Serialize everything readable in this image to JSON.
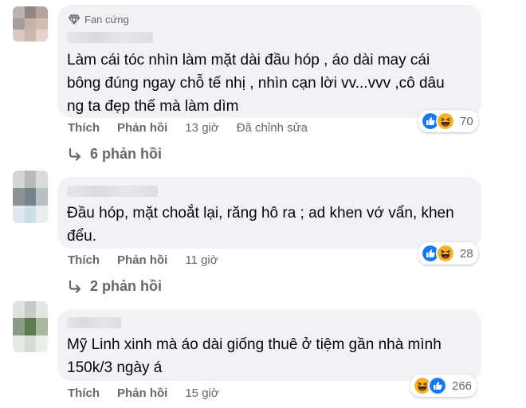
{
  "comments": [
    {
      "badge": "Fan cứng",
      "text": "Làm cái tóc nhìn làm mặt dài đầu hóp , áo dài may cái\nbông đúng ngay chỗ tế nhị , nhìn cạn lời vv...vvv ,cô dâu\nng ta đẹp thế mà làm dìm",
      "like": "Thích",
      "reply": "Phản hồi",
      "time": "13 giờ",
      "edited": "Đã chỉnh sửa",
      "reaction_count": "70",
      "replies": "6 phản hồi"
    },
    {
      "text": "Đầu hóp, mặt choắt lại, răng hô ra ; ad khen vớ vẩn, khen\nđểu.",
      "like": "Thích",
      "reply": "Phản hồi",
      "time": "11 giờ",
      "reaction_count": "28",
      "replies": "2 phản hồi"
    },
    {
      "text": "Mỹ Linh xinh mà áo dài giống thuê ở tiệm gần nhà mình\n150k/3 ngày á",
      "like": "Thích",
      "reply": "Phản hồi",
      "time": "15 giờ",
      "reaction_count": "266"
    }
  ],
  "colors": {
    "bubble": "#f0f2f5",
    "secondary_text": "#65676b",
    "like_blue": "#1877f2",
    "haha_yellow": "#f7b125"
  },
  "icons": [
    "diamond-icon",
    "like-reaction-icon",
    "haha-reaction-icon",
    "reply-arrow-icon"
  ]
}
